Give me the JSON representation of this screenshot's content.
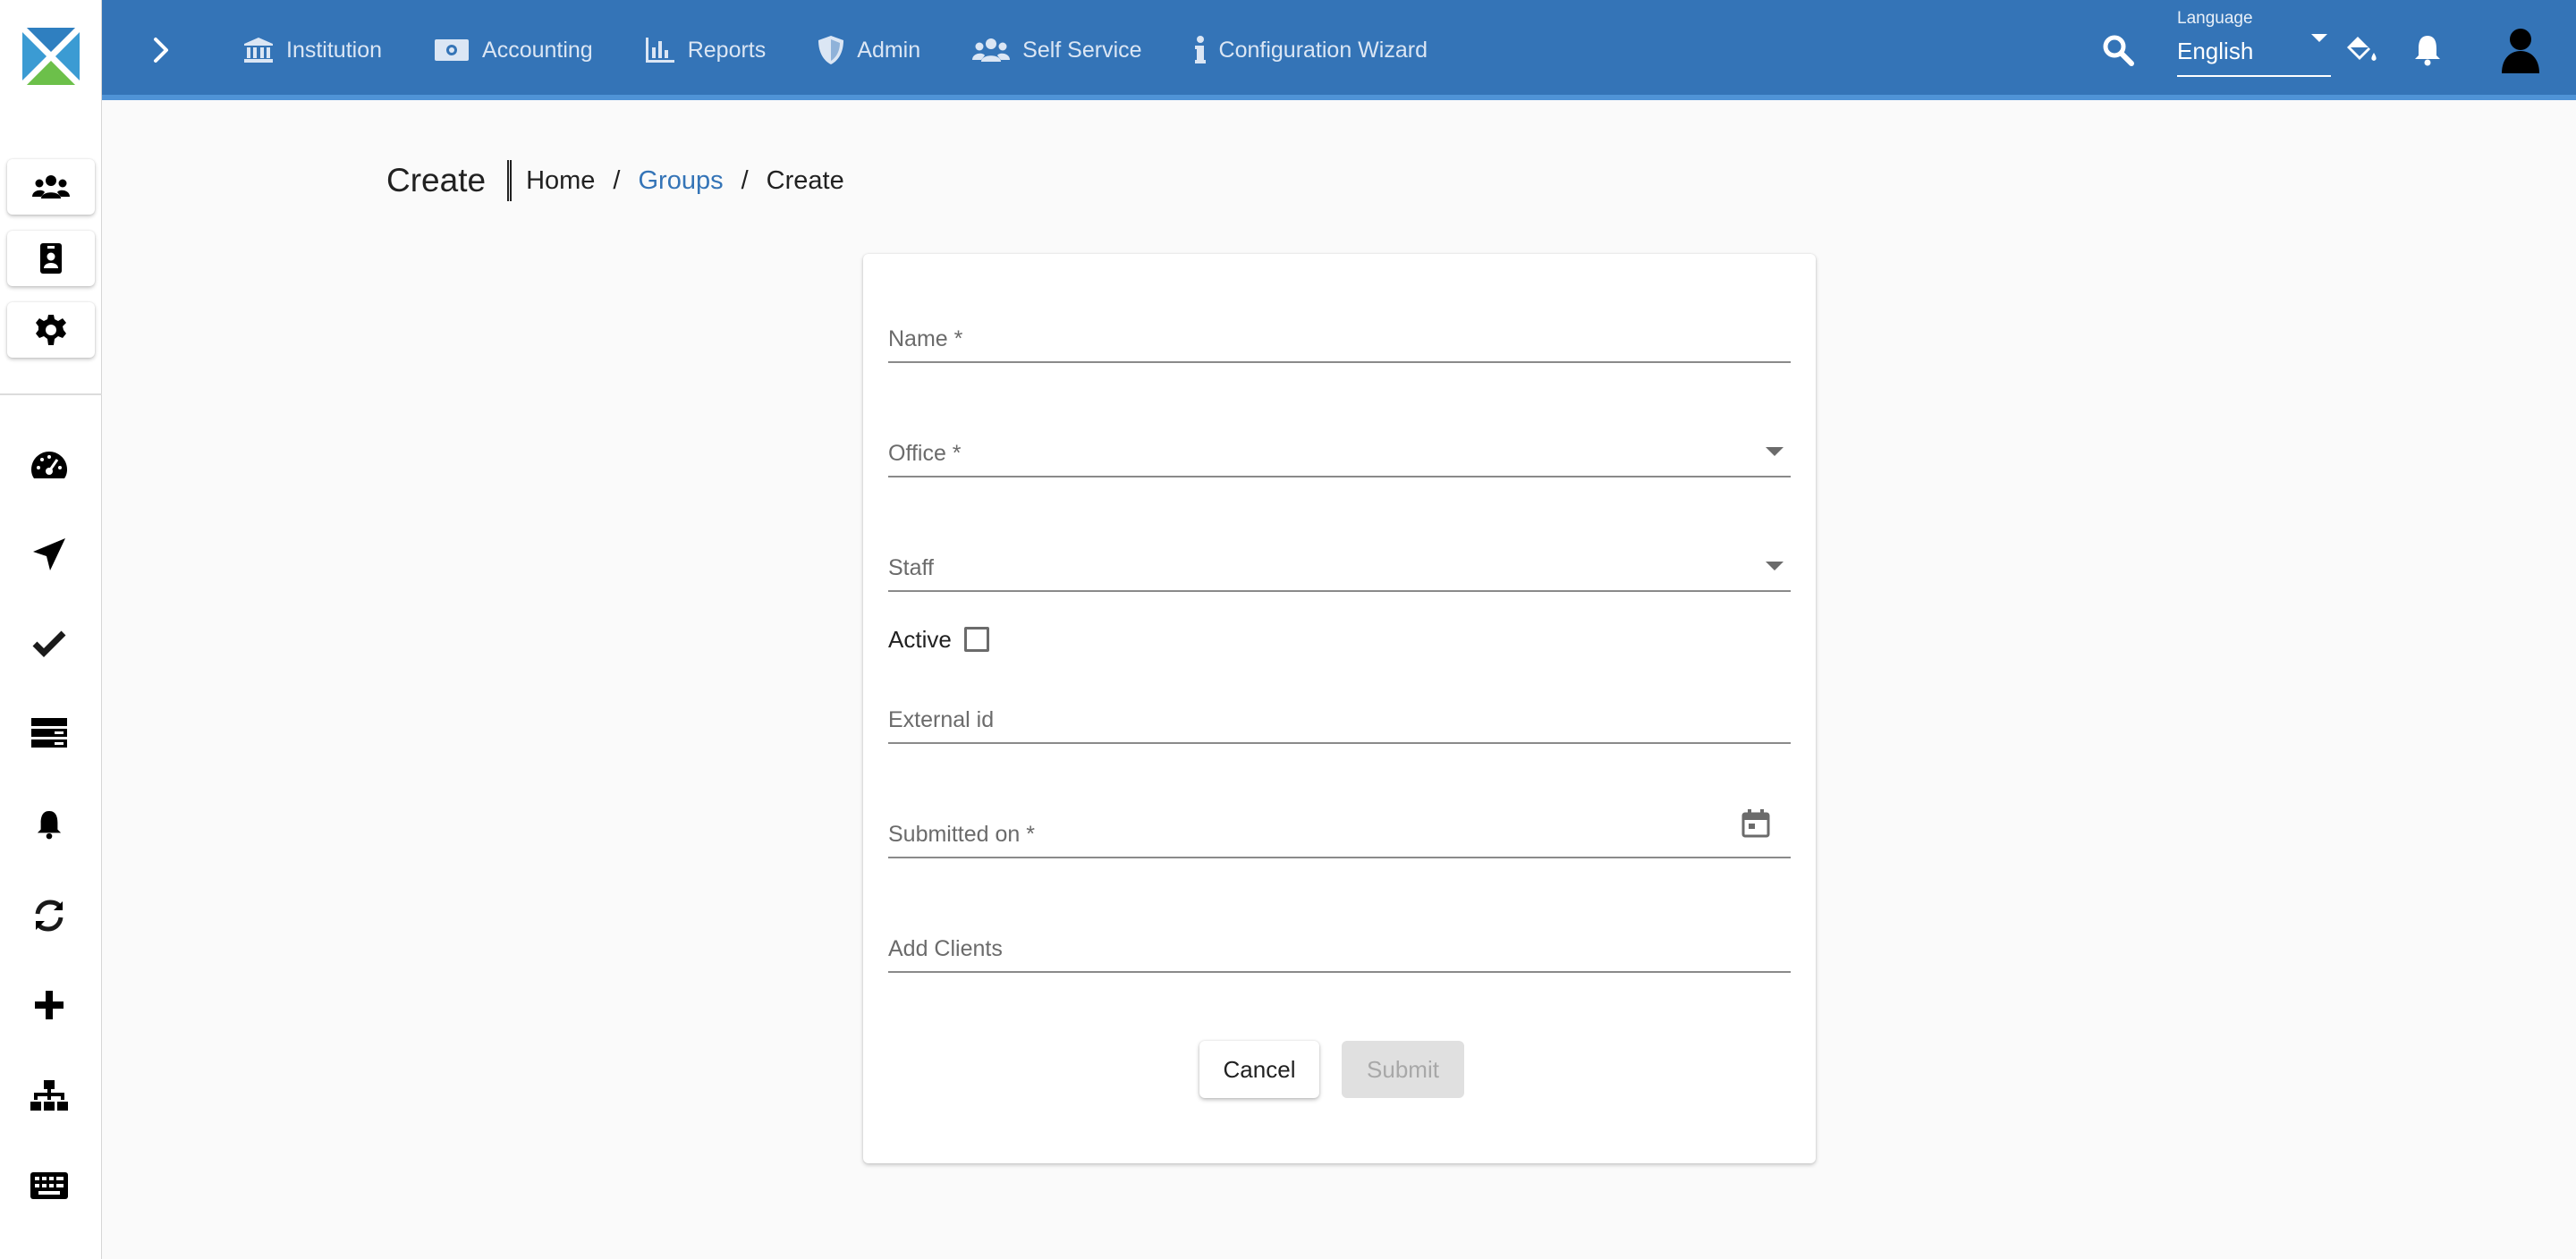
{
  "topbar": {
    "nav": [
      {
        "label": "Institution",
        "icon": "institution-icon"
      },
      {
        "label": "Accounting",
        "icon": "money-icon"
      },
      {
        "label": "Reports",
        "icon": "chart-bar-icon"
      },
      {
        "label": "Admin",
        "icon": "shield-icon"
      },
      {
        "label": "Self Service",
        "icon": "users-icon"
      },
      {
        "label": "Configuration Wizard",
        "icon": "info-icon"
      }
    ],
    "language": {
      "label": "Language",
      "value": "English"
    }
  },
  "breadcrumb": {
    "title": "Create",
    "items": [
      "Home",
      "Groups",
      "Create"
    ],
    "separator": "/"
  },
  "form": {
    "name_label": "Name *",
    "office_label": "Office *",
    "staff_label": "Staff",
    "active_label": "Active",
    "active_checked": false,
    "external_id_label": "External id",
    "submitted_on_label": "Submitted on *",
    "add_clients_label": "Add Clients",
    "cancel_label": "Cancel",
    "submit_label": "Submit",
    "submit_disabled": true
  },
  "colors": {
    "primary": "#3474b7",
    "topbar_accent": "#4f93d6",
    "background": "#fafafa",
    "disabled_button": "#e0e0e0"
  }
}
